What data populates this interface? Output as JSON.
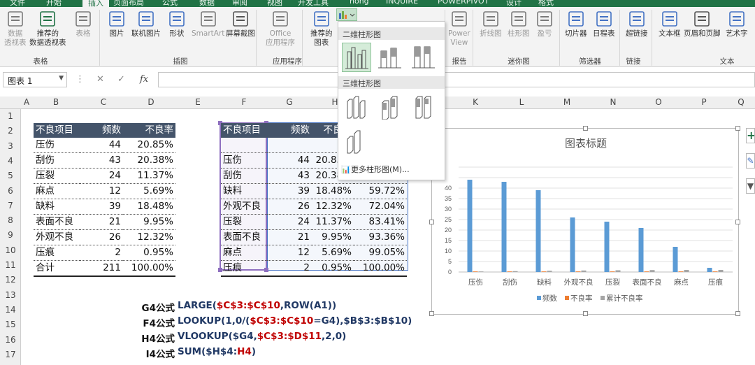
{
  "ribbon": {
    "tabs": [
      "文件",
      "开始",
      "插入",
      "页面布局",
      "公式",
      "数据",
      "审阅",
      "视图",
      "开发工具",
      "nong",
      "INQUIRE",
      "POWERPIVOT",
      "设计",
      "格式"
    ],
    "active_tab": "插入",
    "buttons": {
      "pivot": "数据\n透视表",
      "rec_pivot": "推荐的\n数据透视表",
      "table": "表格",
      "picture": "图片",
      "online_pic": "联机图片",
      "shapes": "形状",
      "smartart": "SmartArt",
      "screenshot": "屏幕截图",
      "office_apps": "Office\n应用程序",
      "rec_chart": "推荐的\n图表",
      "power_view": "Power\nView",
      "line_spark": "折线图",
      "col_spark": "柱形图",
      "winloss": "盈亏",
      "slicer": "切片器",
      "timeline": "日程表",
      "hyperlink": "超链接",
      "textbox": "文本框",
      "header_footer": "页眉和页脚",
      "wordart": "艺术字"
    },
    "groups": {
      "tables": "表格",
      "illustrations": "插图",
      "apps": "应用程序",
      "reports": "报告",
      "sparklines": "迷你图",
      "filters": "筛选器",
      "links": "链接",
      "text": "文本"
    }
  },
  "dropdown": {
    "section_2d": "二维柱形图",
    "section_3d": "三维柱形图",
    "more": "更多柱形图(M)..."
  },
  "formula_bar": {
    "name_box": "图表 1",
    "fx": "fx",
    "value": ""
  },
  "columns": [
    "A",
    "B",
    "C",
    "D",
    "E",
    "F",
    "G",
    "H",
    "I",
    "J",
    "K",
    "L",
    "M",
    "N",
    "O",
    "P",
    "Q"
  ],
  "rows": [
    "1",
    "2",
    "3",
    "4",
    "5",
    "6",
    "7",
    "8",
    "9",
    "10",
    "11",
    "12",
    "13",
    "14",
    "15",
    "16",
    "17"
  ],
  "table1": {
    "headers": [
      "不良项目",
      "频数",
      "不良率"
    ],
    "rows": [
      [
        "压伤",
        "44",
        "20.85%"
      ],
      [
        "刮伤",
        "43",
        "20.38%"
      ],
      [
        "压裂",
        "24",
        "11.37%"
      ],
      [
        "麻点",
        "12",
        "5.69%"
      ],
      [
        "缺料",
        "39",
        "18.48%"
      ],
      [
        "表面不良",
        "21",
        "9.95%"
      ],
      [
        "外观不良",
        "26",
        "12.32%"
      ],
      [
        "压痕",
        "2",
        "0.95%"
      ],
      [
        "合计",
        "211",
        "100.00%"
      ]
    ]
  },
  "table2": {
    "headers": [
      "不良项目",
      "频数",
      "不良率",
      ""
    ],
    "rows": [
      [
        "",
        "",
        "",
        ""
      ],
      [
        "压伤",
        "44",
        "20.85%",
        ""
      ],
      [
        "刮伤",
        "43",
        "20.38%",
        ""
      ],
      [
        "缺料",
        "39",
        "18.48%",
        "59.72%"
      ],
      [
        "外观不良",
        "26",
        "12.32%",
        "72.04%"
      ],
      [
        "压裂",
        "24",
        "11.37%",
        "83.41%"
      ],
      [
        "表面不良",
        "21",
        "9.95%",
        "93.36%"
      ],
      [
        "麻点",
        "12",
        "5.69%",
        "99.05%"
      ],
      [
        "压痕",
        "2",
        "0.95%",
        "100.00%"
      ]
    ]
  },
  "formulas": [
    {
      "label": "G4公式",
      "parts": [
        {
          "t": "LARGE(",
          "c": "b"
        },
        {
          "t": "$C$3:$C$10",
          "c": "r"
        },
        {
          "t": ",ROW(A1))",
          "c": "b"
        }
      ]
    },
    {
      "label": "F4公式",
      "parts": [
        {
          "t": "LOOKUP(1,0/(",
          "c": "b"
        },
        {
          "t": "$C$3:$C$10",
          "c": "r"
        },
        {
          "t": "=G4),$B$3:$B$10)",
          "c": "b"
        }
      ]
    },
    {
      "label": "H4公式",
      "parts": [
        {
          "t": "VLOOKUP($G4,",
          "c": "b"
        },
        {
          "t": "$C$3:$D$11",
          "c": "r"
        },
        {
          "t": ",2,0)",
          "c": "b"
        }
      ]
    },
    {
      "label": "I4公式",
      "parts": [
        {
          "t": "SUM($H$4:",
          "c": "b"
        },
        {
          "t": "H4",
          "c": "r"
        },
        {
          "t": ")",
          "c": "b"
        }
      ]
    }
  ],
  "chart_data": {
    "type": "bar",
    "title": "图表标题",
    "categories": [
      "压伤",
      "刮伤",
      "缺料",
      "外观不良",
      "压裂",
      "表面不良",
      "麻点",
      "压痕"
    ],
    "series": [
      {
        "name": "频数",
        "color": "#5b9bd5",
        "values": [
          44,
          43,
          39,
          26,
          24,
          21,
          12,
          2
        ]
      },
      {
        "name": "不良率",
        "color": "#ed7d31",
        "values": [
          0.2085,
          0.2038,
          0.1848,
          0.1232,
          0.1137,
          0.0995,
          0.0569,
          0.0095
        ]
      },
      {
        "name": "累计不良率",
        "color": "#a5a5a5",
        "values": [
          0.2085,
          0.4123,
          0.5972,
          0.7204,
          0.8341,
          0.9336,
          0.9905,
          1.0
        ]
      }
    ],
    "yticks": [
      "0",
      "5",
      "10",
      "15",
      "20",
      "25",
      "30",
      "35",
      "40"
    ],
    "ylim": [
      0,
      50
    ],
    "legend_position": "bottom",
    "grid": true
  }
}
